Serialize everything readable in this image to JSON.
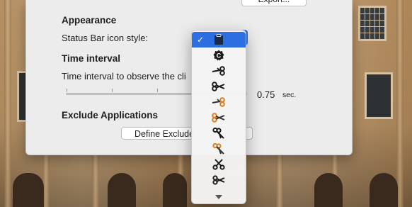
{
  "window": {
    "export_label": "Export..."
  },
  "appearance": {
    "heading": "Appearance",
    "icon_style_label": "Status Bar icon style:"
  },
  "time_interval": {
    "heading": "Time interval",
    "description": "Time interval to observe the cli",
    "slider_value": "0.75",
    "slider_unit": "sec."
  },
  "exclude": {
    "heading": "Exclude Applications",
    "button_label": "Define Exclude"
  },
  "icon_menu": {
    "selected_index": 0,
    "items": [
      {
        "icon": "clipboard-icon"
      },
      {
        "icon": "c-gear-icon"
      },
      {
        "icon": "scissors-icon"
      },
      {
        "icon": "scissors-open-icon"
      },
      {
        "icon": "scissors-orange-icon"
      },
      {
        "icon": "scissors-orange-open-icon"
      },
      {
        "icon": "scissors-diagonal-icon"
      },
      {
        "icon": "scissors-orange-diagonal-icon"
      },
      {
        "icon": "scissors-vertical-icon"
      },
      {
        "icon": "scissors-small-icon"
      }
    ],
    "colors": {
      "selected": "#2d6fe3",
      "accent": "#e07b1a",
      "icon": "#1a1a1a"
    }
  }
}
